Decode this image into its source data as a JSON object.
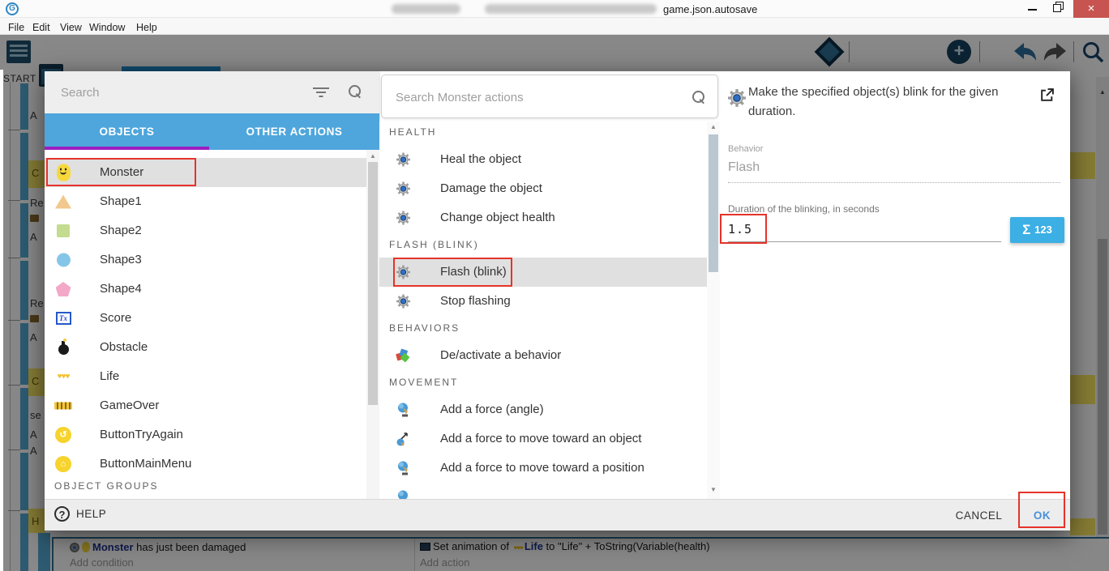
{
  "window": {
    "title": "game.json.autosave",
    "menu": [
      "File",
      "Edit",
      "View",
      "Window",
      "Help"
    ]
  },
  "colors": {
    "tab_blue": "#4EA6DC",
    "tab_underline_purple": "#9B1FC1",
    "annotation_red": "#E5332A",
    "expr_button_blue": "#3CAFE4",
    "ok_blue": "#4A90D9",
    "close_red": "#C75450",
    "selected_row_gray": "#E0E0E0"
  },
  "dialog": {
    "left": {
      "search_placeholder": "Search",
      "tabs": [
        {
          "label": "OBJECTS",
          "selected": true
        },
        {
          "label": "OTHER ACTIONS",
          "selected": false
        }
      ],
      "objects": [
        {
          "name": "Monster",
          "icon": "monster",
          "selected": true
        },
        {
          "name": "Shape1",
          "icon": "triangle"
        },
        {
          "name": "Shape2",
          "icon": "square"
        },
        {
          "name": "Shape3",
          "icon": "circle"
        },
        {
          "name": "Shape4",
          "icon": "pentagon"
        },
        {
          "name": "Score",
          "icon": "text-object"
        },
        {
          "name": "Obstacle",
          "icon": "bomb"
        },
        {
          "name": "Life",
          "icon": "hearts"
        },
        {
          "name": "GameOver",
          "icon": "banner"
        },
        {
          "name": "ButtonTryAgain",
          "icon": "retry-button"
        },
        {
          "name": "ButtonMainMenu",
          "icon": "home-button"
        }
      ],
      "groups_header": "OBJECT GROUPS"
    },
    "middle": {
      "search_placeholder": "Search Monster actions",
      "sections": [
        {
          "header": "HEALTH",
          "items": [
            {
              "label": "Heal the object"
            },
            {
              "label": "Damage the object"
            },
            {
              "label": "Change object health"
            }
          ]
        },
        {
          "header": "FLASH (BLINK)",
          "items": [
            {
              "label": "Flash (blink)",
              "selected": true
            },
            {
              "label": "Stop flashing"
            }
          ]
        },
        {
          "header": "BEHAVIORS",
          "items": [
            {
              "label": "De/activate a behavior"
            }
          ]
        },
        {
          "header": "MOVEMENT",
          "items": [
            {
              "label": "Add a force (angle)"
            },
            {
              "label": "Add a force to move toward an object"
            },
            {
              "label": "Add a force to move toward a position"
            }
          ]
        }
      ]
    },
    "right": {
      "description": "Make the specified object(s) blink for the given duration.",
      "behavior_label": "Behavior",
      "behavior_value": "Flash",
      "duration_label": "Duration of the blinking, in seconds",
      "duration_value": "1.5",
      "expr_button_label": "123"
    },
    "footer": {
      "help": "HELP",
      "cancel": "CANCEL",
      "ok": "OK"
    }
  },
  "events": {
    "start_tab": "START",
    "left_fragments": [
      "A",
      "C",
      "Re",
      "A",
      "Re",
      "A",
      "C",
      "se",
      "A",
      "A",
      "H"
    ],
    "bottom_row": {
      "condition_object": "Monster",
      "condition_text": " has just been damaged",
      "add_condition": "Add condition",
      "action_prefix": "Set animation of ",
      "action_object": "Life",
      "action_suffix": " to \"Life\" + ToString(Variable(health)",
      "add_action": "Add action"
    }
  }
}
